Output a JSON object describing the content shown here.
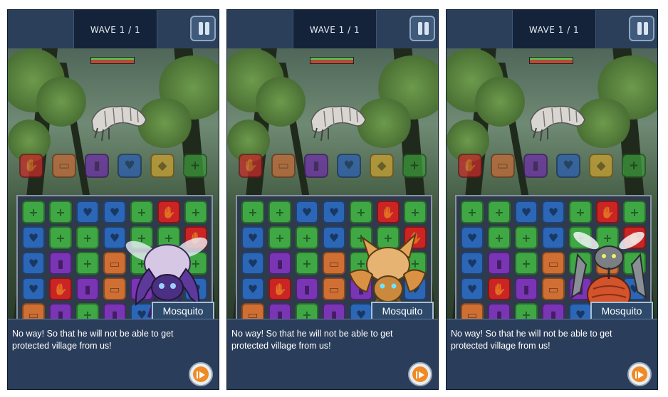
{
  "panels": [
    {
      "wave": "WAVE 1 / 1",
      "monster_name": "Mosquito",
      "dialog": "No way! So that he will not be able to  get protected village from us!",
      "monster_palette": "purple"
    },
    {
      "wave": "WAVE 1 / 1",
      "monster_name": "Mosquito",
      "dialog": "No way! So that he will not be able to  get protected village from us!",
      "monster_palette": "orange"
    },
    {
      "wave": "WAVE 1 / 1",
      "monster_name": "Mosquito",
      "dialog": "No way! So that he will not be able to  get protected village from us!",
      "monster_palette": "grey"
    }
  ],
  "mana_row": [
    {
      "color": "#c62b2b",
      "icon": "hand-icon"
    },
    {
      "color": "#c46a38",
      "icon": "vest-icon"
    },
    {
      "color": "#6d2fa6",
      "icon": "potion-icon"
    },
    {
      "color": "#2c5fb0",
      "icon": "heart-shield-icon"
    },
    {
      "color": "#c9a030",
      "icon": "diamond-icon"
    },
    {
      "color": "#3d9a3d",
      "icon": "plus-icon"
    }
  ],
  "board_rows": [
    [
      "green",
      "green",
      "blue",
      "blue",
      "green",
      "red",
      "green"
    ],
    [
      "blue",
      "green",
      "green",
      "blue",
      "green",
      "green",
      "red"
    ],
    [
      "blue",
      "purple",
      "green",
      "orange",
      "green",
      "orange",
      "green"
    ],
    [
      "blue",
      "red",
      "purple",
      "orange",
      "purple",
      "blue",
      "blue"
    ],
    [
      "orange",
      "purple",
      "green",
      "purple",
      "blue",
      "orange",
      "blue"
    ]
  ],
  "colors": {
    "accent": "#f08a23",
    "panel_bg": "#22344e",
    "dialog_bg": "#2a3d5a"
  },
  "icons": [
    "pause-icon",
    "next-arrow-icon"
  ]
}
